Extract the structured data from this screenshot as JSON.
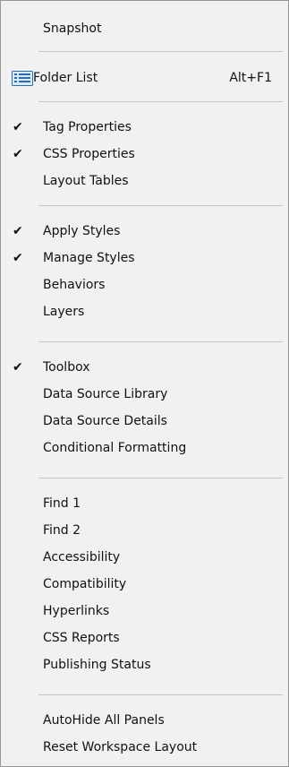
{
  "menu": {
    "items": [
      {
        "label": "Snapshot"
      },
      {
        "label": "Folder List",
        "shortcut": "Alt+F1",
        "icon": "folder-list-icon"
      },
      {
        "label": "Tag Properties",
        "checked": true
      },
      {
        "label": "CSS Properties",
        "checked": true
      },
      {
        "label": "Layout Tables"
      },
      {
        "label": "Apply Styles",
        "checked": true
      },
      {
        "label": "Manage Styles",
        "checked": true
      },
      {
        "label": "Behaviors"
      },
      {
        "label": "Layers"
      },
      {
        "label": "Toolbox",
        "checked": true
      },
      {
        "label": "Data Source Library"
      },
      {
        "label": "Data Source Details"
      },
      {
        "label": "Conditional Formatting"
      },
      {
        "label": "Find 1"
      },
      {
        "label": "Find 2"
      },
      {
        "label": "Accessibility"
      },
      {
        "label": "Compatibility"
      },
      {
        "label": "Hyperlinks"
      },
      {
        "label": "CSS Reports"
      },
      {
        "label": "Publishing Status"
      },
      {
        "label": "AutoHide All Panels"
      },
      {
        "label": "Reset Workspace Layout"
      }
    ],
    "check_glyph": "✔"
  }
}
